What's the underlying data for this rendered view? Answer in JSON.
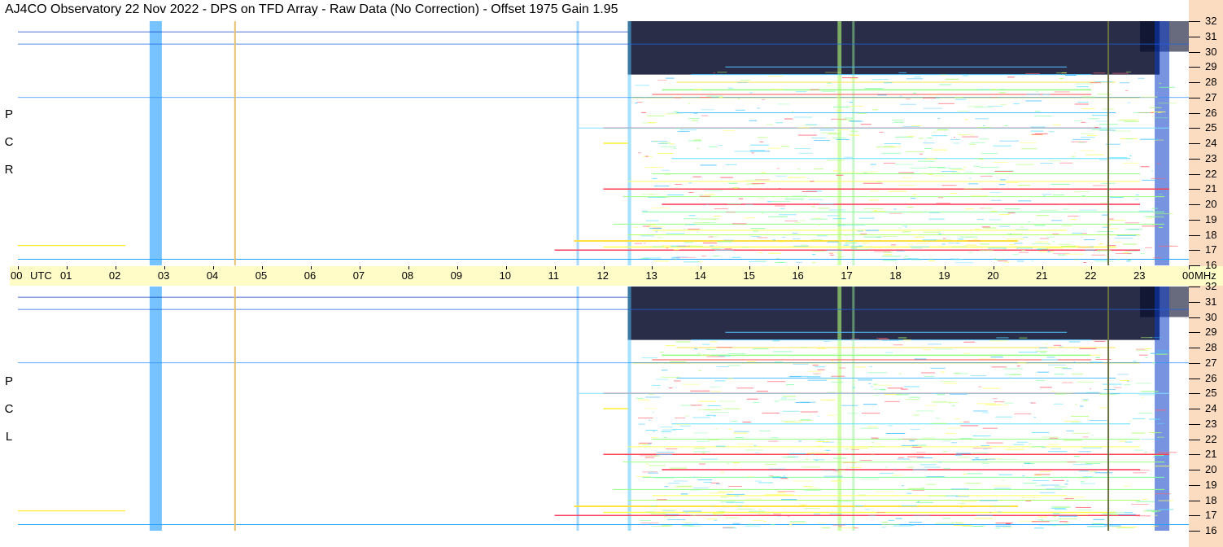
{
  "title": "AJ4CO Observatory  22 Nov 2022  -  DPS on TFD Array  -  Raw Data (No Correction)  -  Offset 1975  Gain 1.95",
  "panels": [
    {
      "polarization": [
        "R",
        "C",
        "P"
      ]
    },
    {
      "polarization": [
        "L",
        "C",
        "P"
      ]
    }
  ],
  "time_axis": {
    "utc_label": "UTC",
    "ticks": [
      "00",
      "01",
      "02",
      "03",
      "04",
      "05",
      "06",
      "07",
      "08",
      "09",
      "10",
      "11",
      "12",
      "13",
      "14",
      "15",
      "16",
      "17",
      "18",
      "19",
      "20",
      "21",
      "22",
      "23",
      "00"
    ],
    "unit": "MHz"
  },
  "freq_axis": {
    "ticks": [
      "32",
      "31",
      "30",
      "29",
      "28",
      "27",
      "26",
      "25",
      "24",
      "23",
      "22",
      "21",
      "20",
      "19",
      "18",
      "17",
      "16"
    ]
  },
  "chart_data": [
    {
      "type": "heatmap",
      "panel": "RCP",
      "x_range_utc_hours": [
        0,
        24
      ],
      "y_range_mhz": [
        16,
        32
      ],
      "colormap": [
        "#0a1030",
        "#0a2fb0",
        "#0a60ff",
        "#20b0ff",
        "#40e0e0",
        "#90ff70",
        "#ffff40",
        "#ff4040"
      ],
      "vertical_markers_utc": [
        4.45,
        22.35
      ],
      "active_window_utc": [
        12.5,
        23.5
      ]
    },
    {
      "type": "heatmap",
      "panel": "LCP",
      "x_range_utc_hours": [
        0,
        24
      ],
      "y_range_mhz": [
        16,
        32
      ],
      "colormap": [
        "#0a1030",
        "#0a2fb0",
        "#0a60ff",
        "#20b0ff",
        "#40e0e0",
        "#90ff70",
        "#ffff40",
        "#ff4040"
      ],
      "vertical_markers_utc": [
        4.45,
        22.35
      ],
      "active_window_utc": [
        12.5,
        23.5
      ]
    }
  ]
}
